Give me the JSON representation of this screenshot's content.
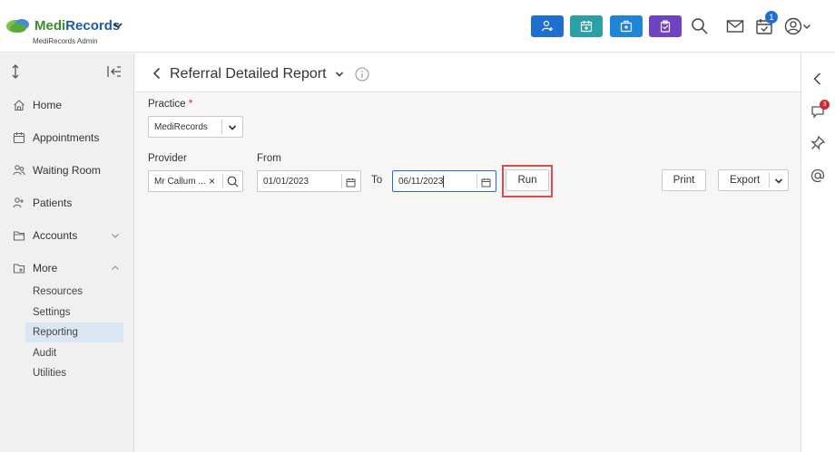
{
  "app": {
    "brand_part1": "Medi",
    "brand_part2": "Records",
    "subtitle": "MediRecords Admin",
    "notification_count": "1"
  },
  "quick_actions": [
    {
      "name": "add-patient",
      "color": "#1f6fd1"
    },
    {
      "name": "appointment",
      "color": "#2ba0a8"
    },
    {
      "name": "clinical",
      "color": "#1f86d6"
    },
    {
      "name": "clipboard",
      "color": "#6f42c1"
    }
  ],
  "sidebar": {
    "items": [
      {
        "label": "Home"
      },
      {
        "label": "Appointments"
      },
      {
        "label": "Waiting Room"
      },
      {
        "label": "Patients"
      },
      {
        "label": "Accounts"
      },
      {
        "label": "More"
      }
    ],
    "more_items": [
      {
        "label": "Resources"
      },
      {
        "label": "Settings"
      },
      {
        "label": "Reporting"
      },
      {
        "label": "Audit"
      },
      {
        "label": "Utilities"
      }
    ]
  },
  "right_rail": {
    "messages_badge": "3"
  },
  "page": {
    "title": "Referral Detailed Report"
  },
  "form": {
    "practice_label": "Practice",
    "practice_required": "*",
    "practice_value": "MediRecords",
    "provider_label": "Provider",
    "provider_value": "Mr Callum ...",
    "provider_clear": "×",
    "from_label": "From",
    "from_value": "01/01/2023",
    "to_label": "To",
    "to_value": "06/11/2023",
    "run_label": "Run",
    "print_label": "Print",
    "export_label": "Export"
  }
}
